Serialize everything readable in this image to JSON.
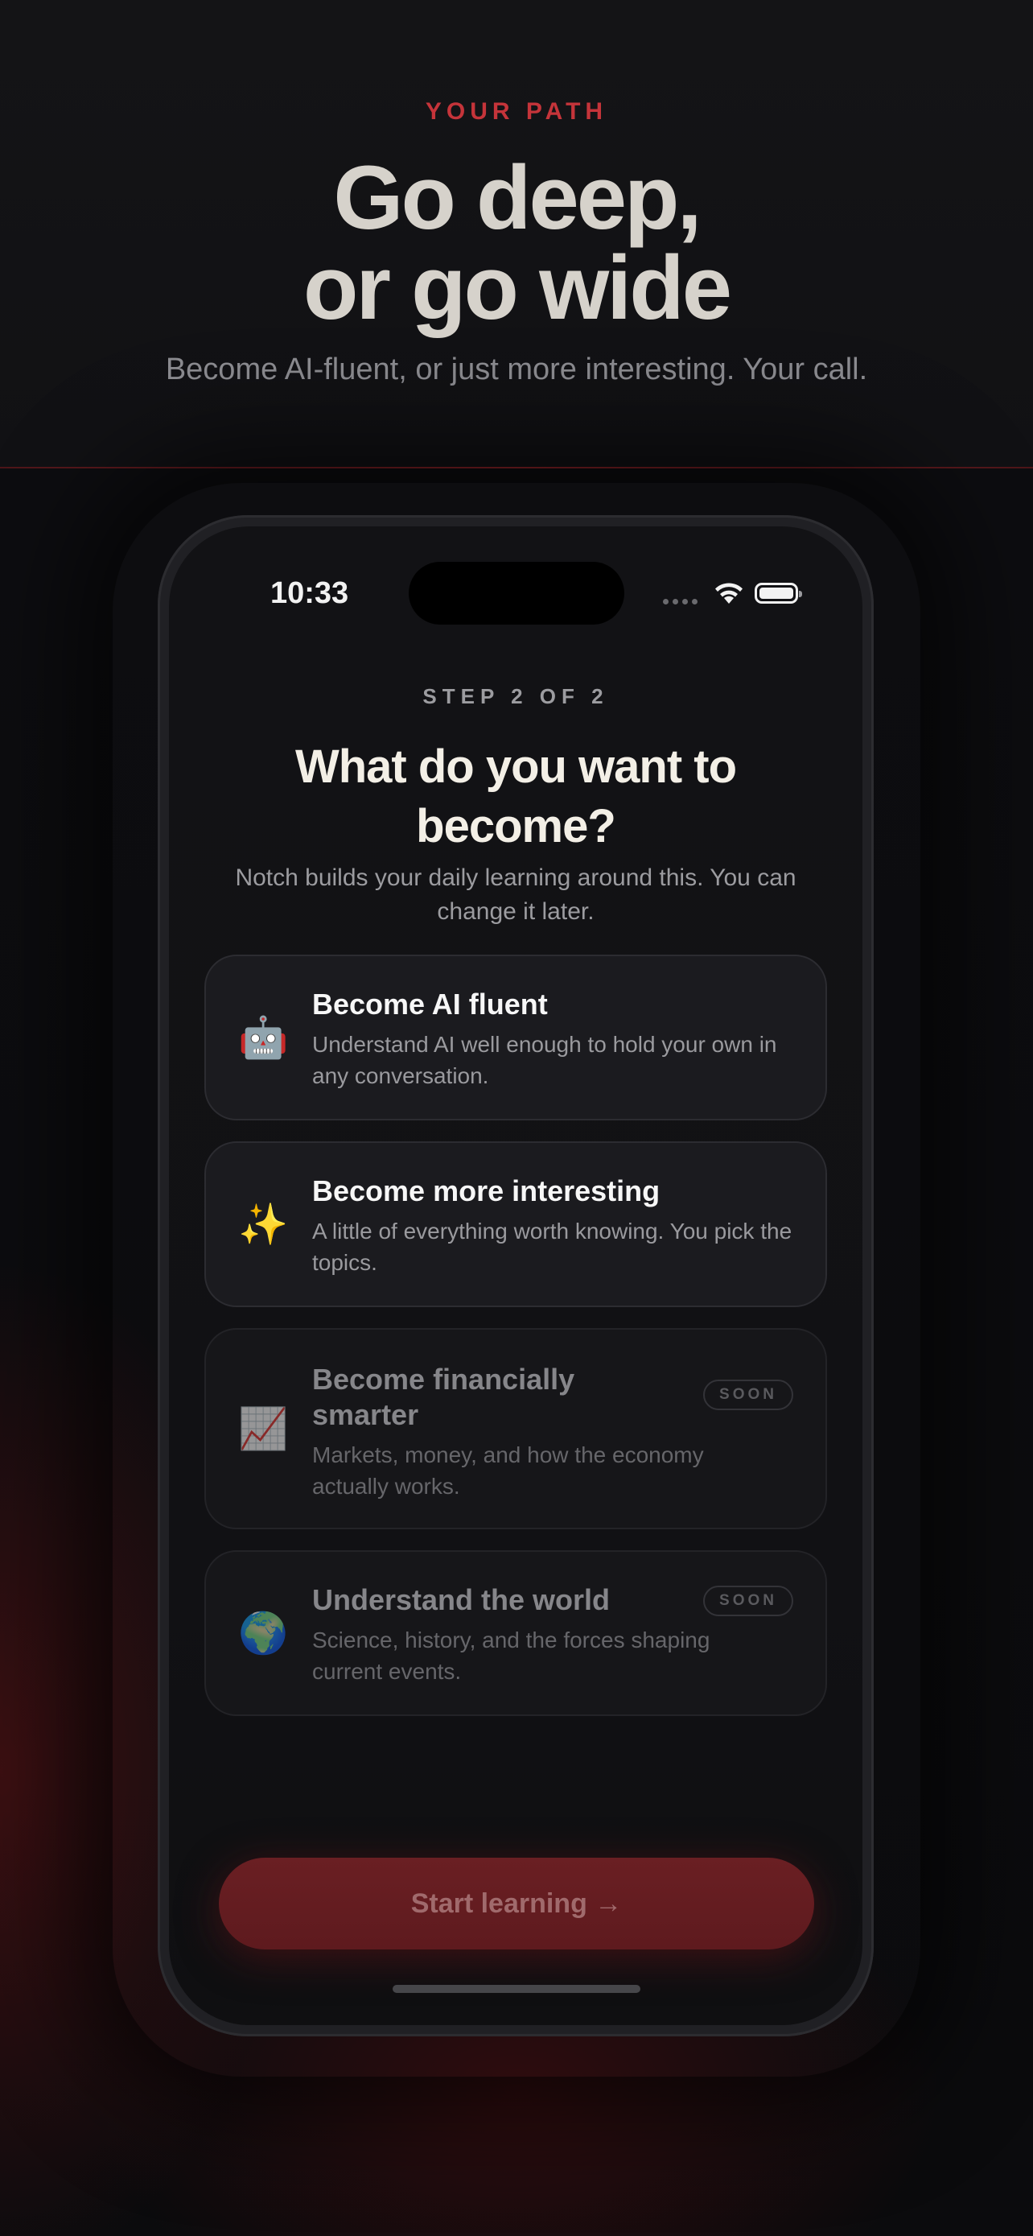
{
  "hero": {
    "eyebrow": "YOUR PATH",
    "title_line1": "Go deep,",
    "title_line2": "or go wide",
    "subtitle": "Become AI-fluent, or just more interesting. Your call."
  },
  "status_bar": {
    "time": "10:33",
    "icons": [
      "signal-dots-icon",
      "wifi-icon",
      "battery-icon"
    ]
  },
  "onboarding": {
    "step": "STEP 2 OF 2",
    "title_line1": "What do you want to",
    "title_line2": "become?",
    "subtitle": "Notch builds your daily learning around this. You can change it later.",
    "options": [
      {
        "emoji": "🤖",
        "icon": "robot-icon",
        "title": "Become AI fluent",
        "description": "Understand AI well enough to hold your own in any conversation.",
        "badge": ""
      },
      {
        "emoji": "✨",
        "icon": "sparkles-icon",
        "title": "Become more interesting",
        "description": "A little of everything worth knowing. You pick the topics.",
        "badge": ""
      },
      {
        "emoji": "📈",
        "icon": "chart-increasing-icon",
        "title": "Become financially smarter",
        "description": "Markets, money, and how the economy actually works.",
        "badge": "SOON"
      },
      {
        "emoji": "🌍",
        "icon": "globe-icon",
        "title": "Understand the world",
        "description": "Science, history, and the forces shaping current events.",
        "badge": "SOON"
      }
    ],
    "cta_label": "Start learning →"
  },
  "colors": {
    "accent": "#c5343a",
    "cta_background": "#6a1f23",
    "background": "#0c0c0e",
    "card": "#1b1b1f"
  }
}
